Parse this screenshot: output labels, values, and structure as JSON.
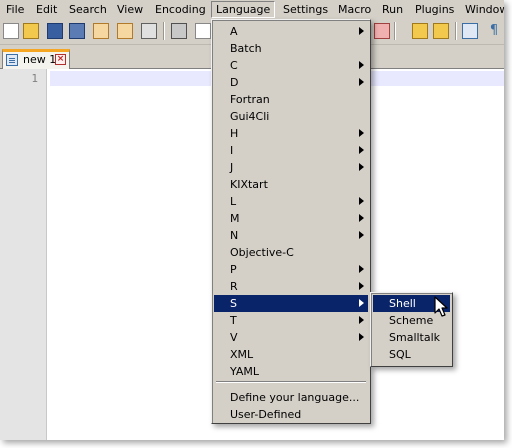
{
  "menubar": {
    "items": [
      "File",
      "Edit",
      "Search",
      "View",
      "Encoding",
      "Language",
      "Settings",
      "Macro",
      "Run",
      "Plugins",
      "Window"
    ]
  },
  "toolbar": {
    "icons": [
      "new-file-icon",
      "open-file-icon",
      "save-icon",
      "save-all-icon",
      "close-icon",
      "close-all-icon",
      "print-icon",
      "cut-icon",
      "copy-icon",
      "paste-icon",
      "undo-icon",
      "redo-icon",
      "find-icon",
      "replace-icon",
      "zoom-in-icon",
      "zoom-out-icon",
      "sync-v-icon",
      "sync-h-icon",
      "word-wrap-icon",
      "show-all-chars-icon"
    ]
  },
  "tab": {
    "label": "new 1",
    "close_glyph": "×"
  },
  "editor": {
    "line_number": "1"
  },
  "language_menu": {
    "items": [
      {
        "label": "A",
        "submenu": true
      },
      {
        "label": "Batch",
        "submenu": false
      },
      {
        "label": "C",
        "submenu": true
      },
      {
        "label": "D",
        "submenu": true
      },
      {
        "label": "Fortran",
        "submenu": false
      },
      {
        "label": "Gui4Cli",
        "submenu": false
      },
      {
        "label": "H",
        "submenu": true
      },
      {
        "label": "I",
        "submenu": true
      },
      {
        "label": "J",
        "submenu": true
      },
      {
        "label": "KIXtart",
        "submenu": false
      },
      {
        "label": "L",
        "submenu": true
      },
      {
        "label": "M",
        "submenu": true
      },
      {
        "label": "N",
        "submenu": true
      },
      {
        "label": "Objective-C",
        "submenu": false
      },
      {
        "label": "P",
        "submenu": true
      },
      {
        "label": "R",
        "submenu": true
      },
      {
        "label": "S",
        "submenu": true,
        "highlighted": true
      },
      {
        "label": "T",
        "submenu": true
      },
      {
        "label": "V",
        "submenu": true
      },
      {
        "label": "XML",
        "submenu": false
      },
      {
        "label": "YAML",
        "submenu": false
      }
    ],
    "footer": [
      "Define your language...",
      "User-Defined"
    ]
  },
  "s_submenu": {
    "items": [
      {
        "label": "Shell",
        "highlighted": true
      },
      {
        "label": "Scheme"
      },
      {
        "label": "Smalltalk"
      },
      {
        "label": "SQL"
      }
    ]
  },
  "colors": {
    "menu_bg": "#d4d0c8",
    "highlight": "#0a246a",
    "current_line": "#e8e8ff",
    "tab_accent": "#f5a623"
  }
}
